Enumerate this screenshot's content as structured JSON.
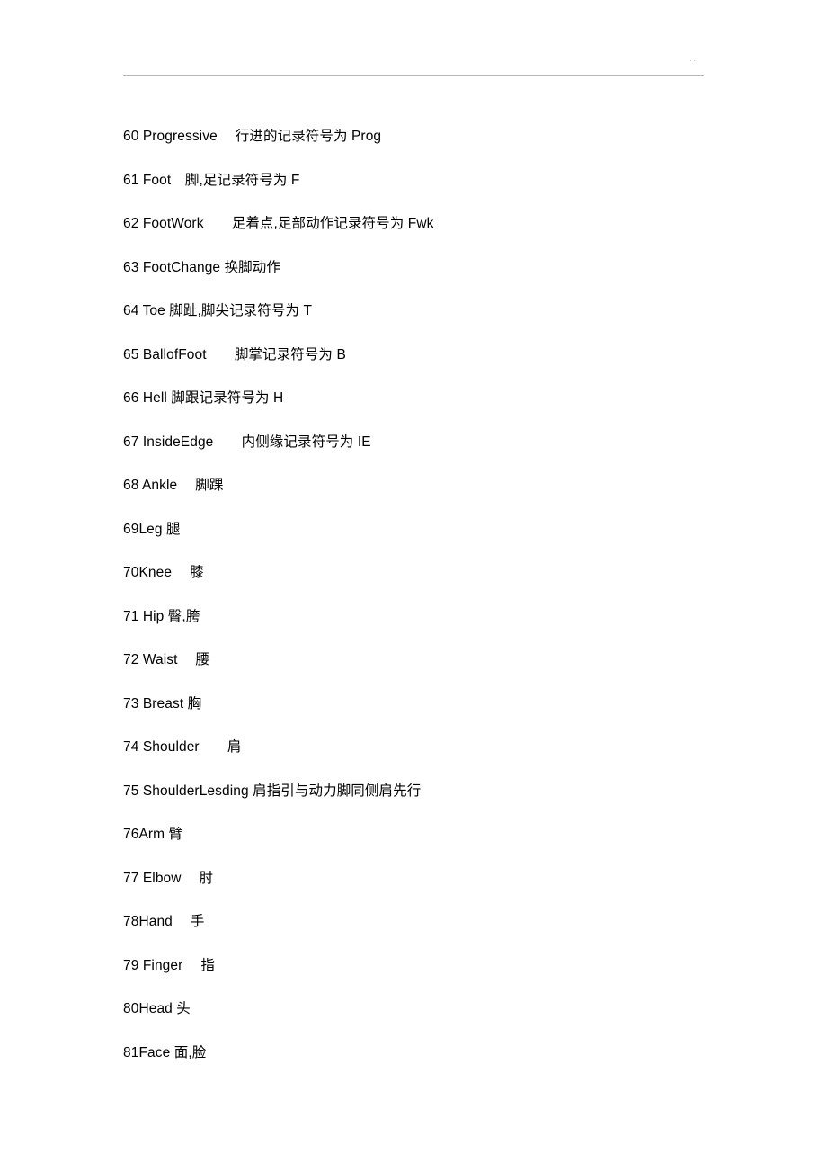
{
  "document": {
    "header": {
      "page_note": "··",
      "rule_color": "#b6b6b6"
    },
    "text_color": "#000000",
    "background_color": "#ffffff",
    "entries": [
      {
        "number": "60",
        "term": "Progressive",
        "chinese": "行进的记录符号为 Prog",
        "line": "60 Progressive　 行进的记录符号为 Prog"
      },
      {
        "number": "61",
        "term": "Foot",
        "chinese": "脚,足记录符号为 F",
        "line": "61 Foot　脚,足记录符号为 F"
      },
      {
        "number": "62",
        "term": "FootWork",
        "chinese": "足着点,足部动作记录符号为 Fwk",
        "line": "62 FootWork　　足着点,足部动作记录符号为 Fwk"
      },
      {
        "number": "63",
        "term": "FootChange",
        "chinese": "换脚动作",
        "line": "63 FootChange 换脚动作"
      },
      {
        "number": "64",
        "term": "Toe",
        "chinese": "脚趾,脚尖记录符号为 T",
        "line": "64 Toe 脚趾,脚尖记录符号为 T"
      },
      {
        "number": "65",
        "term": "BallofFoot",
        "chinese": "脚掌记录符号为 B",
        "line": "65 BallofFoot　　脚掌记录符号为 B"
      },
      {
        "number": "66",
        "term": "Hell",
        "chinese": "脚跟记录符号为 H",
        "line": "66 Hell 脚跟记录符号为 H"
      },
      {
        "number": "67",
        "term": "InsideEdge",
        "chinese": "内侧缘记录符号为 IE",
        "line": "67 InsideEdge　　内侧缘记录符号为 IE"
      },
      {
        "number": "68",
        "term": "Ankle",
        "chinese": "脚踝",
        "line": "68 Ankle　 脚踝"
      },
      {
        "number": "69",
        "term": "Leg",
        "chinese": "腿",
        "line": "69Leg 腿"
      },
      {
        "number": "70",
        "term": "Knee",
        "chinese": "膝",
        "line": "70Knee　 膝"
      },
      {
        "number": "71",
        "term": "Hip",
        "chinese": "臀,胯",
        "line": "71 Hip 臀,胯"
      },
      {
        "number": "72",
        "term": "Waist",
        "chinese": "腰",
        "line": "72 Waist　 腰"
      },
      {
        "number": "73",
        "term": "Breast",
        "chinese": "胸",
        "line": "73 Breast 胸"
      },
      {
        "number": "74",
        "term": "Shoulder",
        "chinese": "肩",
        "line": "74 Shoulder　　肩"
      },
      {
        "number": "75",
        "term": "ShoulderLesding",
        "chinese": "肩指引与动力脚同侧肩先行",
        "line": "75 ShoulderLesding 肩指引与动力脚同侧肩先行"
      },
      {
        "number": "76",
        "term": "Arm",
        "chinese": "臂",
        "line": "76Arm 臂"
      },
      {
        "number": "77",
        "term": "Elbow",
        "chinese": "肘",
        "line": "77 Elbow　 肘"
      },
      {
        "number": "78",
        "term": "Hand",
        "chinese": "手",
        "line": "78Hand　 手"
      },
      {
        "number": "79",
        "term": "Finger",
        "chinese": "指",
        "line": "79 Finger　 指"
      },
      {
        "number": "80",
        "term": "Head",
        "chinese": "头",
        "line": "80Head 头"
      },
      {
        "number": "81",
        "term": "Face",
        "chinese": "面,脸",
        "line": "81Face 面,脸"
      }
    ]
  }
}
